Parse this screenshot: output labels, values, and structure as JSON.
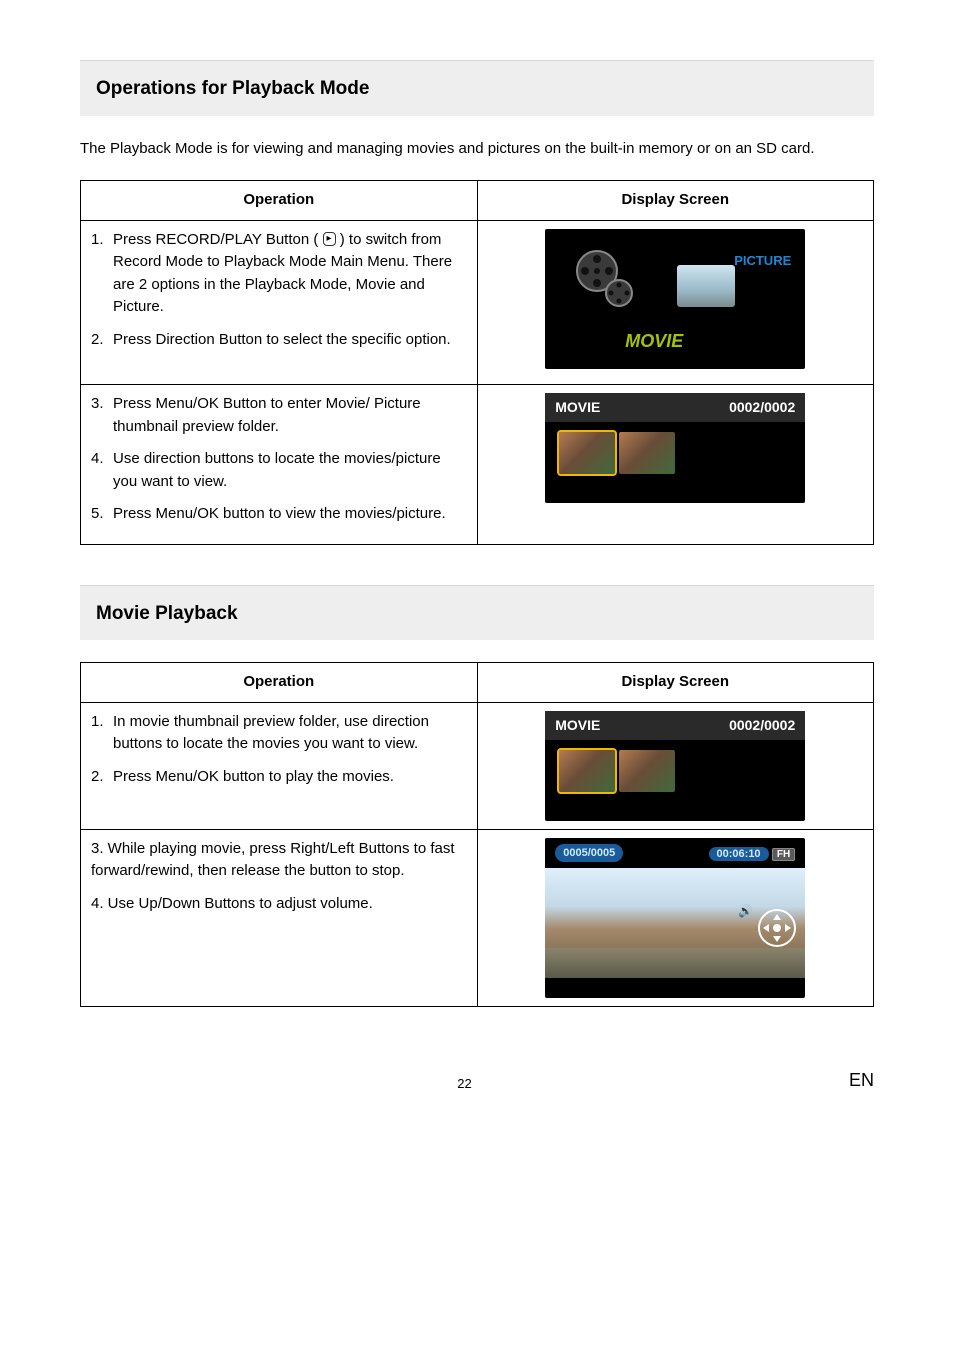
{
  "sections": {
    "playback_ops": {
      "title": "Operations for Playback Mode",
      "intro": "The Playback Mode is for viewing and managing movies and pictures on the built-in memory or on an SD card.",
      "table": {
        "headers": {
          "op": "Operation",
          "disp": "Display Screen"
        },
        "rows": [
          {
            "steps": [
              {
                "num": "1.",
                "text_pre": "Press RECORD/PLAY Button (",
                "icon": "▸",
                "text_post": ") to switch from Record Mode to Playback Mode Main Menu. There are 2 options in the Playback Mode, Movie and Picture."
              },
              {
                "num": "2.",
                "text": "Press Direction Button to select the specific option."
              }
            ],
            "screen": {
              "picture_label": "PICTURE",
              "movie_label": "MOVIE"
            }
          },
          {
            "steps": [
              {
                "num": "3.",
                "text": "Press Menu/OK Button to enter Movie/ Picture thumbnail preview folder."
              },
              {
                "num": "4.",
                "text": "Use direction buttons to locate the movies/picture you want to view."
              },
              {
                "num": "5.",
                "text": "Press Menu/OK button to view the movies/picture."
              }
            ],
            "screen": {
              "hdr_left": "MOVIE",
              "hdr_right": "0002/0002"
            }
          }
        ]
      }
    },
    "movie_playback": {
      "title": "Movie Playback",
      "table": {
        "headers": {
          "op": "Operation",
          "disp": "Display Screen"
        },
        "rows": [
          {
            "steps": [
              {
                "num": "1.",
                "text": "In movie thumbnail preview folder, use direction buttons to locate the movies you want to view."
              },
              {
                "num": "2.",
                "text": "Press Menu/OK button to play the movies."
              }
            ],
            "screen": {
              "hdr_left": "MOVIE",
              "hdr_right": "0002/0002"
            }
          },
          {
            "steps_plain": [
              "3. While playing movie, press Right/Left Buttons to fast forward/rewind, then release the button to stop.",
              "4. Use Up/Down Buttons to adjust volume."
            ],
            "screen_play": {
              "counter": "0005/0005",
              "time": "00:06:10",
              "fh": "FH"
            }
          }
        ]
      }
    }
  },
  "footer": {
    "page": "22",
    "lang": "EN"
  }
}
